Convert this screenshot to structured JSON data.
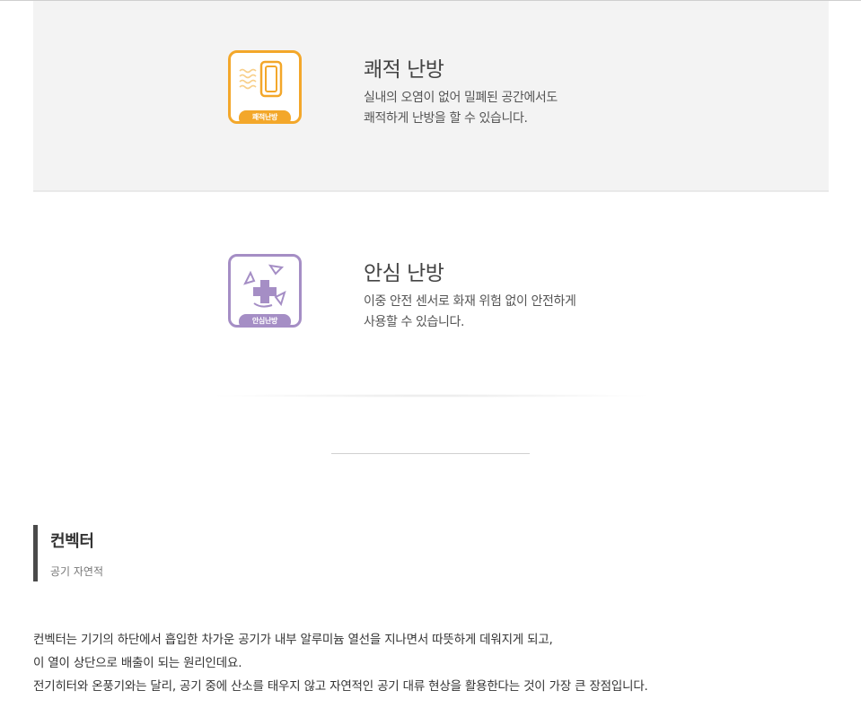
{
  "features": [
    {
      "key": "comfort",
      "icon": "comfort-heating-icon",
      "icon_tag": "쾌적난방",
      "title": "쾌적 난방",
      "desc_lines": [
        "실내의 오염이 없어 밀폐된 공간에서도",
        "쾌적하게 난방을 할 수 있습니다."
      ],
      "accent": "#f3a72a",
      "background": "#f3f3f3"
    },
    {
      "key": "safe",
      "icon": "safe-heating-icon",
      "icon_tag": "안심난방",
      "title": "안심 난방",
      "desc_lines": [
        "이중 안전 센서로 화재 위험 없이 안전하게",
        "사용할 수 있습니다."
      ],
      "accent": "#a58ec5",
      "background": "#ffffff"
    }
  ],
  "section": {
    "title": "컨벡터",
    "subtitle": "공기 자연적",
    "accent_bar_color": "#4a4a4a",
    "body_lines": [
      "컨벡터는 기기의 하단에서 흡입한 차가운 공기가 내부 알루미늄 열선을 지나면서 따뜻하게 데워지게 되고,",
      "이 열이 상단으로 배출이 되는 원리인데요.",
      "전기히터와 온풍기와는 달리, 공기 중에 산소를 태우지 않고 자연적인 공기 대류 현상을 활용한다는 것이 가장 큰 장점입니다."
    ]
  }
}
